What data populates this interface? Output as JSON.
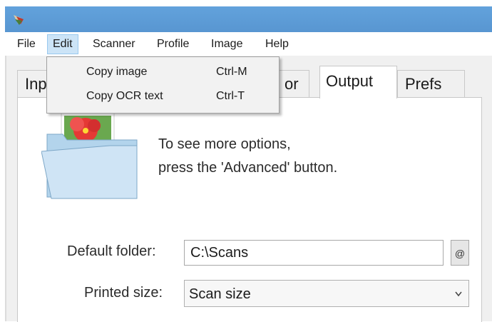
{
  "menubar": {
    "items": [
      "File",
      "Edit",
      "Scanner",
      "Profile",
      "Image",
      "Help"
    ],
    "active": "Edit"
  },
  "edit_menu": {
    "items": [
      {
        "label": "Copy image",
        "shortcut": "Ctrl-M"
      },
      {
        "label": "Copy OCR text",
        "shortcut": "Ctrl-T"
      }
    ]
  },
  "tabs": {
    "input_partial": "Inp",
    "color_partial": "or",
    "output": "Output",
    "prefs": "Prefs",
    "selected": "Output"
  },
  "hint": {
    "line1": "To see more options,",
    "line2": "press the 'Advanced' button."
  },
  "form": {
    "default_folder_label": "Default folder:",
    "default_folder_value": "C:\\Scans",
    "at_button": "@",
    "printed_size_label": "Printed size:",
    "printed_size_value": "Scan size"
  },
  "icons": {
    "app": "scanner-app-icon",
    "folder": "folder-with-photo-icon",
    "dropdown": "chevron-down-icon"
  },
  "colors": {
    "titlebar": "#5b9bd5",
    "menu_highlight": "#cce4f7"
  }
}
